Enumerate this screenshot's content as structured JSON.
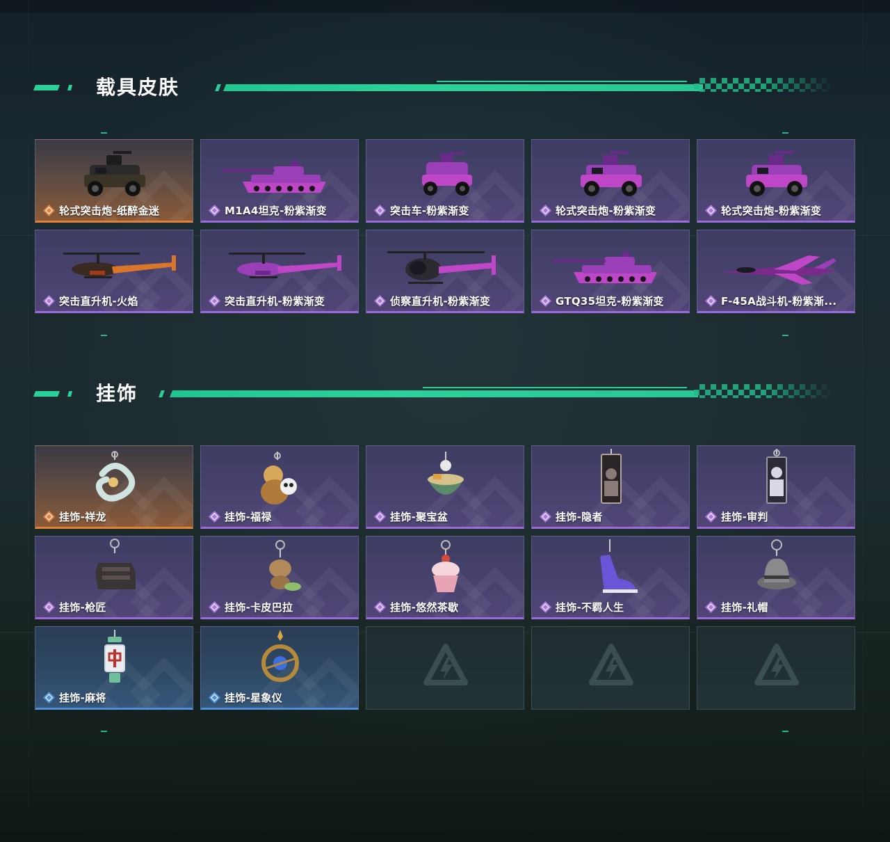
{
  "sections": [
    {
      "title": "载具皮肤",
      "items": [
        {
          "name": "轮式突击炮-纸醉金迷",
          "rarity": "orange",
          "icon": "armored-car-icon"
        },
        {
          "name": "M1A4坦克-粉紫渐变",
          "rarity": "purple",
          "icon": "tank-icon"
        },
        {
          "name": "突击车-粉紫渐变",
          "rarity": "purple",
          "icon": "assault-vehicle-icon"
        },
        {
          "name": "轮式突击炮-粉紫渐变",
          "rarity": "purple",
          "icon": "armored-car-icon"
        },
        {
          "name": "轮式突击炮-粉紫渐变",
          "rarity": "purple",
          "icon": "armored-car-icon"
        },
        {
          "name": "突击直升机-火焰",
          "rarity": "purple",
          "icon": "attack-helicopter-icon"
        },
        {
          "name": "突击直升机-粉紫渐变",
          "rarity": "purple",
          "icon": "attack-helicopter-icon"
        },
        {
          "name": "侦察直升机-粉紫渐变",
          "rarity": "purple",
          "icon": "scout-helicopter-icon"
        },
        {
          "name": "GTQ35坦克-粉紫渐变",
          "rarity": "purple",
          "icon": "tank-icon"
        },
        {
          "name": "F-45A战斗机-粉紫渐...",
          "rarity": "purple",
          "icon": "fighter-jet-icon"
        }
      ]
    },
    {
      "title": "挂饰",
      "items": [
        {
          "name": "挂饰-祥龙",
          "rarity": "orange",
          "icon": "dragon-charm-icon"
        },
        {
          "name": "挂饰-福禄",
          "rarity": "purple",
          "icon": "gourd-charm-icon"
        },
        {
          "name": "挂饰-聚宝盆",
          "rarity": "purple",
          "icon": "treasure-bowl-charm-icon"
        },
        {
          "name": "挂饰-隐者",
          "rarity": "purple",
          "icon": "hermit-card-charm-icon"
        },
        {
          "name": "挂饰-审判",
          "rarity": "purple",
          "icon": "judgement-card-charm-icon"
        },
        {
          "name": "挂饰-枪匠",
          "rarity": "purple",
          "icon": "gunsmith-box-charm-icon"
        },
        {
          "name": "挂饰-卡皮巴拉",
          "rarity": "purple",
          "icon": "capybara-charm-icon"
        },
        {
          "name": "挂饰-悠然茶歇",
          "rarity": "purple",
          "icon": "cupcake-charm-icon"
        },
        {
          "name": "挂饰-不羁人生",
          "rarity": "purple",
          "icon": "sneaker-charm-icon"
        },
        {
          "name": "挂饰-礼帽",
          "rarity": "purple",
          "icon": "hat-charm-icon"
        },
        {
          "name": "挂饰-麻将",
          "rarity": "blue",
          "icon": "mahjong-charm-icon"
        },
        {
          "name": "挂饰-星象仪",
          "rarity": "blue",
          "icon": "astrolabe-charm-icon"
        }
      ],
      "empty_slots": 3
    }
  ],
  "colors": {
    "accent": "#2ad29a",
    "rarity_orange": "#e0803a",
    "rarity_purple": "#9b6bdc",
    "rarity_blue": "#4f8fd8"
  }
}
